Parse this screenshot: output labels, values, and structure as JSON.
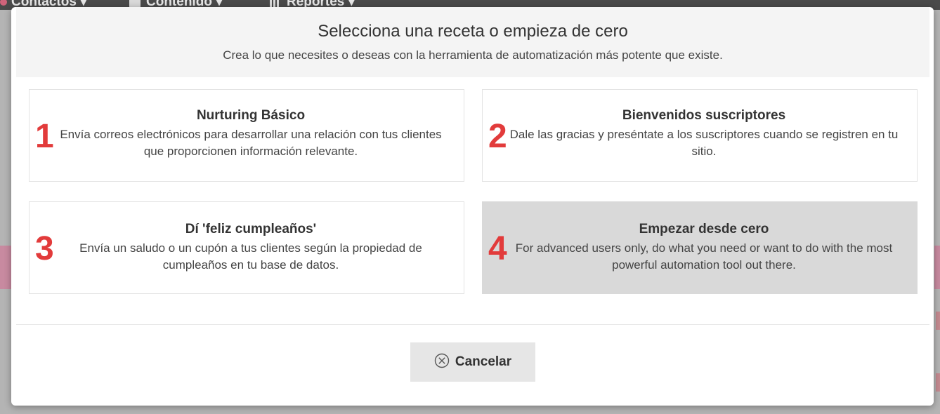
{
  "background": {
    "nav": {
      "contacts_label": "Contactos ▾",
      "content_label": "Contenido ▾",
      "reports_label": "Reportes ▾"
    }
  },
  "modal": {
    "title": "Selecciona una receta o empieza de cero",
    "subtitle": "Crea lo que necesites o deseas con la herramienta de automatización más potente que existe.",
    "recipes": [
      {
        "number": "1",
        "title": "Nurturing Básico",
        "description": "Envía correos electrónicos para desarrollar una relación con tus clientes que proporcionen información relevante."
      },
      {
        "number": "2",
        "title": "Bienvenidos suscriptores",
        "description": "Dale las gracias y preséntate a los suscriptores cuando se registren en tu sitio."
      },
      {
        "number": "3",
        "title": "Dí 'feliz cumpleaños'",
        "description": "Envía un saludo o un cupón a tus clientes según la propiedad de cumpleaños en tu base de datos."
      },
      {
        "number": "4",
        "title": "Empezar desde cero",
        "description": "For advanced users only, do what you need or want to do with the most powerful automation tool out there.",
        "selected": true
      }
    ],
    "cancel_label": "Cancelar",
    "cancel_icon": "circle-x-icon"
  },
  "colors": {
    "number_accent": "#e23b3b",
    "selected_card": "#d9d9d9",
    "header_bg": "#f4f4f4"
  }
}
